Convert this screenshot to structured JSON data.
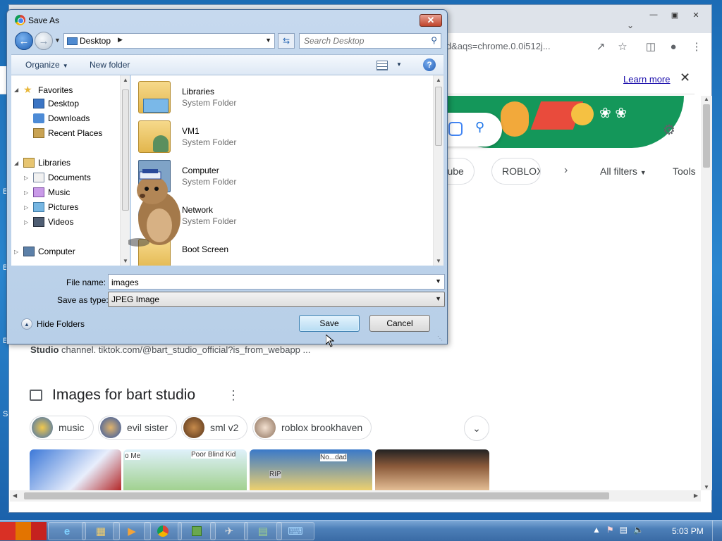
{
  "browser": {
    "omnibox_text": "rt+stud&aqs=chrome.0.0i512j...",
    "infobar": {
      "learn_more": "Learn more"
    },
    "chips": [
      "outube",
      "ROBLOX"
    ],
    "filters": {
      "all_filters": "All filters",
      "tools": "Tools"
    },
    "snippet": {
      "bold": "Studio",
      "rest": " channel. tiktok.com/@bart_studio_official?is_from_webapp ..."
    },
    "images_section": {
      "title": "Images for bart studio",
      "chips": [
        "music",
        "evil sister",
        "sml v2",
        "roblox brookhaven"
      ],
      "thumb_captions": [
        "o Me",
        "Poor Blind Kid",
        "No...dad",
        "RIP"
      ]
    }
  },
  "dialog": {
    "title": "Save As",
    "address": "Desktop",
    "search_placeholder": "Search Desktop",
    "toolbar": {
      "organize": "Organize",
      "new_folder": "New folder"
    },
    "nav": {
      "favorites": "Favorites",
      "desktop": "Desktop",
      "downloads": "Downloads",
      "recent_places": "Recent Places",
      "libraries": "Libraries",
      "documents": "Documents",
      "music": "Music",
      "pictures": "Pictures",
      "videos": "Videos",
      "computer": "Computer"
    },
    "files": [
      {
        "name": "Libraries",
        "type": "System Folder"
      },
      {
        "name": "VM1",
        "type": "System Folder"
      },
      {
        "name": "Computer",
        "type": "System Folder"
      },
      {
        "name": "Network",
        "type": "System Folder"
      },
      {
        "name": "Boot Screen",
        "type": ""
      }
    ],
    "file_name_label": "File name:",
    "file_name_value": "images",
    "save_type_label": "Save as type:",
    "save_type_value": "JPEG Image",
    "hide_folders": "Hide Folders",
    "save_button": "Save",
    "cancel_button": "Cancel"
  },
  "taskbar": {
    "clock": "5:03 PM"
  },
  "colors": {
    "accent": "#1a73e8",
    "doodle_green": "#14975a",
    "dialog_frame": "#b8cfe8",
    "taskbar": "#3a6ba5"
  }
}
